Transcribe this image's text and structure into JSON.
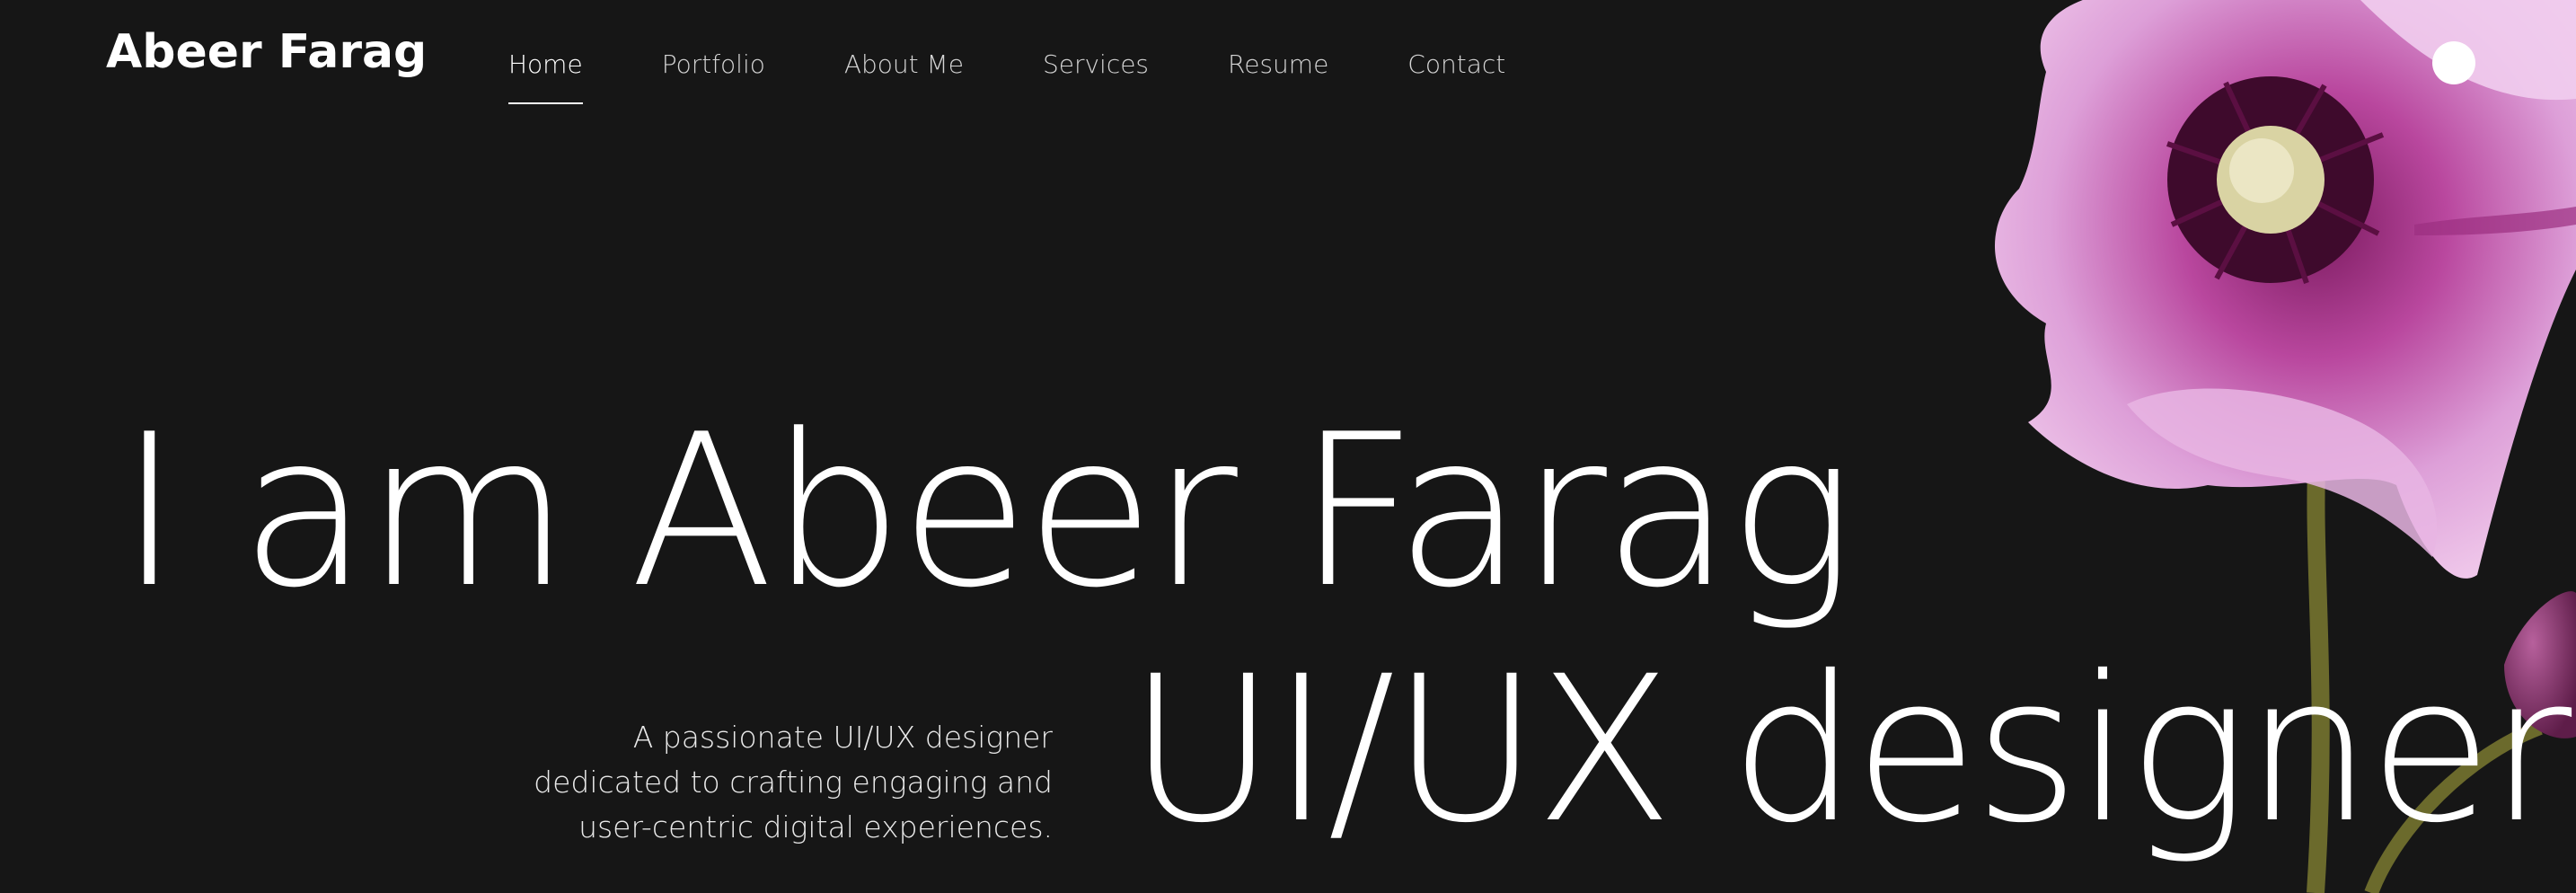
{
  "header": {
    "logo": "Abeer Farag",
    "nav": [
      {
        "label": "Home",
        "active": true
      },
      {
        "label": "Portfolio",
        "active": false
      },
      {
        "label": "About Me",
        "active": false
      },
      {
        "label": "Services",
        "active": false
      },
      {
        "label": "Resume",
        "active": false
      },
      {
        "label": "Contact",
        "active": false
      }
    ],
    "theme_toggle_icon": "circle-icon"
  },
  "hero": {
    "title": "I am Abeer Farag",
    "role": "UI/UX designer",
    "tagline": [
      "A passionate UI/UX designer",
      "dedicated to crafting engaging and",
      "user-centric digital experiences."
    ],
    "image": "pink-flower-image"
  },
  "colors": {
    "background": "#161616",
    "text": "#ffffff",
    "flower_petal": "#e3a6df",
    "flower_center": "#5b0f42",
    "stem": "#6b6a2c"
  }
}
